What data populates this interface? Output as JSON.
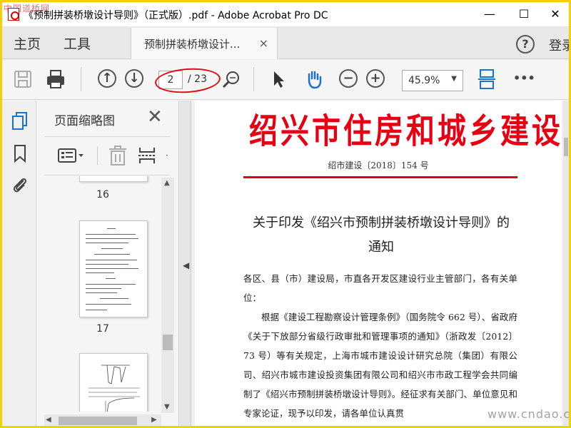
{
  "window": {
    "title": "《预制拼装桥墩设计导则》（正式版）.pdf - Adobe Acrobat Pro DC",
    "watermark_top": "中国道桥网",
    "minimize": "—",
    "maximize": "☐",
    "close": "✕"
  },
  "tabs": {
    "home": "主页",
    "tools": "工具",
    "document_tab": "预制拼装桥墩设计...",
    "close_tab": "×",
    "help": "?",
    "login": "登录"
  },
  "toolbar": {
    "current_page": "2",
    "total_pages": "/ 23",
    "zoom": "45.9%",
    "more": "•••"
  },
  "thumbnails_panel": {
    "title": "页面缩略图",
    "pages": [
      "16",
      "17"
    ]
  },
  "document": {
    "header": "绍兴市住房和城乡建设局文件",
    "doc_number": "绍市建设〔2018〕154 号",
    "subject_line1": "关于印发《绍兴市预制拼装桥墩设计导则》的",
    "subject_line2": "通知",
    "addressee": "各区、县（市）建设局，市直各开发区建设行业主管部门，各有关单位：",
    "paragraph": "根据《建设工程勘察设计管理条例》（国务院令 662 号）、省政府《关于下放部分省级行政审批和管理事项的通知》（浙政发〔2012〕73 号）等有关规定，上海市城市建设设计研究总院（集团）有限公司、绍兴市城市建设投资集团有限公司和绍兴市市政工程学会共同编制了《绍兴市预制拼装桥墩设计导则》。经征求有关部门、单位意见和专家论证，现予以印发，请各单位认真贯"
  },
  "watermark_bottom": "www.cndao.com",
  "colors": {
    "header_red": "#e60012",
    "frame_yellow": "#f4d100",
    "annotation_red": "#dd1010",
    "icon_blue": "#1a73c8"
  }
}
